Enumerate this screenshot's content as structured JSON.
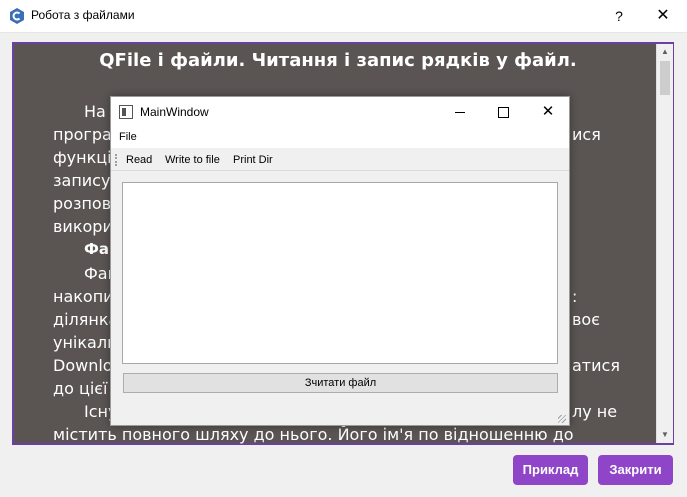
{
  "dialog": {
    "title": "Робота з файлами",
    "help_glyph": "?",
    "close_glyph": "✕",
    "buttons": {
      "example": "Приклад",
      "close": "Закрити"
    },
    "accent_color": "#8f45c7"
  },
  "lesson": {
    "title": "QFile і файли. Читання і запис рядків у файл.",
    "lines": [
      "На",
      "програ",
      "функці",
      "запису",
      "розпов",
      "викори",
      "Фай",
      "Фай",
      "накопи",
      "ділянка",
      "унікаль",
      "Downlo",
      "до цієї",
      "Існу",
      "містить повного шляху до нього. Його ім'я по відношенню до"
    ],
    "right_fragments": [
      "ися",
      ":",
      "воє",
      "атися",
      "лу не"
    ]
  },
  "scroll_arrows": {
    "up": "▲",
    "down": "▼"
  },
  "main_window": {
    "title": "MainWindow",
    "close_glyph": "✕",
    "menu": {
      "file": "File"
    },
    "toolbar": {
      "read": "Read",
      "write": "Write to file",
      "print": "Print Dir"
    },
    "textarea_value": "",
    "read_button": "Зчитати файл"
  }
}
